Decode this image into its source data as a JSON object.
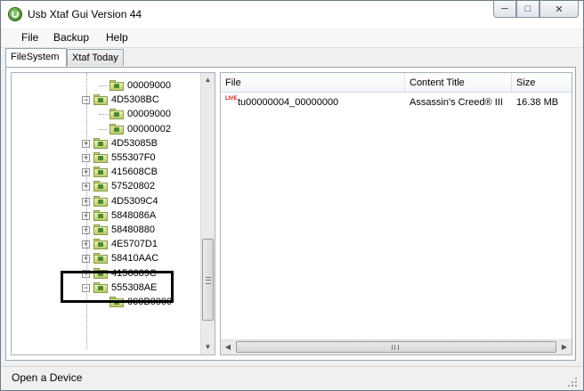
{
  "window": {
    "title": "Usb Xtaf Gui Version 44",
    "minimize_glyph": "─",
    "maximize_glyph": "□",
    "close_glyph": "✕"
  },
  "menu": {
    "file": "File",
    "backup": "Backup",
    "help": "Help"
  },
  "tabs": [
    {
      "label": "FileSystem",
      "active": true
    },
    {
      "label": "Xtaf Today",
      "active": false
    }
  ],
  "tree": {
    "nodes": [
      {
        "label": "00009000",
        "level": 2,
        "expander": ""
      },
      {
        "label": "4D5308BC",
        "level": 1,
        "expander": "−"
      },
      {
        "label": "00009000",
        "level": 2,
        "expander": ""
      },
      {
        "label": "00000002",
        "level": 2,
        "expander": ""
      },
      {
        "label": "4D53085B",
        "level": 1,
        "expander": "+"
      },
      {
        "label": "555307F0",
        "level": 1,
        "expander": "+"
      },
      {
        "label": "415608CB",
        "level": 1,
        "expander": "+"
      },
      {
        "label": "57520802",
        "level": 1,
        "expander": "+"
      },
      {
        "label": "4D5309C4",
        "level": 1,
        "expander": "+"
      },
      {
        "label": "5848086A",
        "level": 1,
        "expander": "+"
      },
      {
        "label": "58480880",
        "level": 1,
        "expander": "+"
      },
      {
        "label": "4E5707D1",
        "level": 1,
        "expander": "+"
      },
      {
        "label": "58410AAC",
        "level": 1,
        "expander": "+"
      },
      {
        "label": "4156089C",
        "level": 1,
        "expander": "+"
      },
      {
        "label": "555308AE",
        "level": 1,
        "expander": "−"
      },
      {
        "label": "000B0000",
        "level": 2,
        "expander": ""
      }
    ],
    "scroll_up": "▲",
    "scroll_down": "▼"
  },
  "list": {
    "columns": [
      "File",
      "Content Title",
      "Size"
    ],
    "rows": [
      {
        "file": "tu00000004_00000000",
        "content_title": "Assassin's Creed® III",
        "size": "16.38 MB",
        "icon": "live-icon"
      }
    ],
    "live_icon_text": "LIVE",
    "scroll_left": "◀",
    "scroll_right": "▶"
  },
  "status": {
    "text": "Open a Device"
  }
}
